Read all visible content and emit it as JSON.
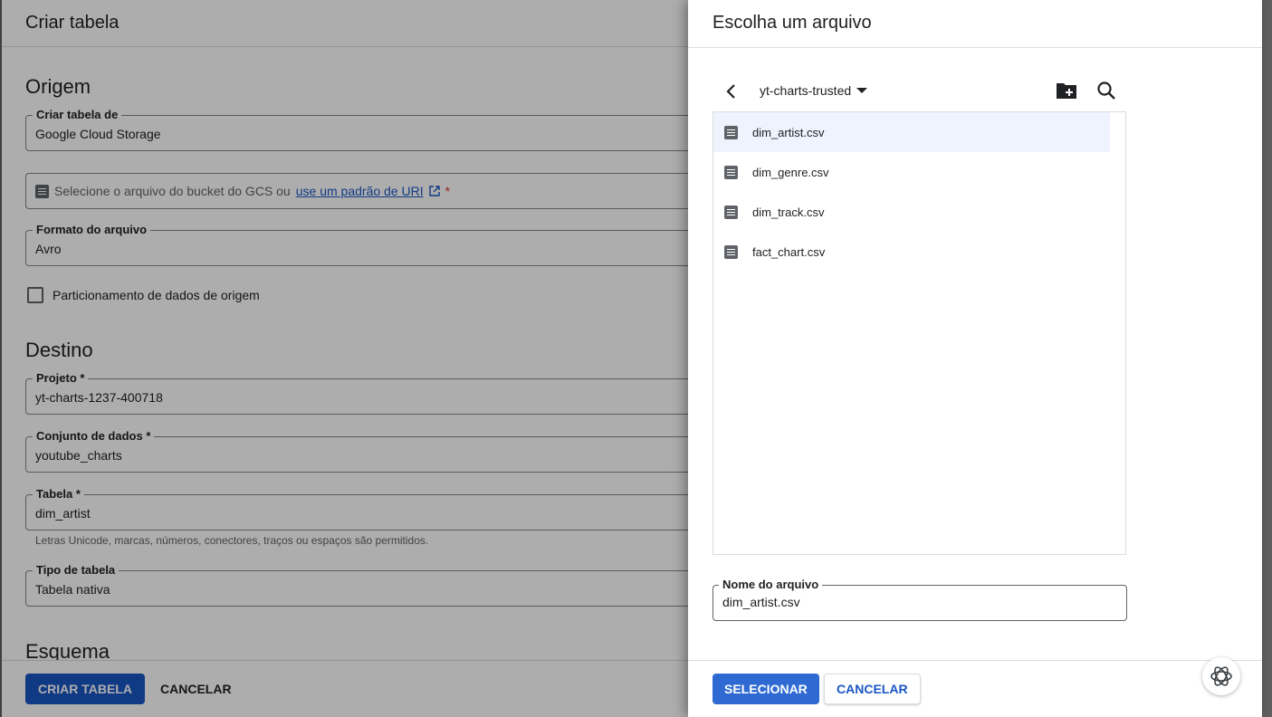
{
  "left": {
    "title": "Criar tabela",
    "origin_title": "Origem",
    "create_from_label": "Criar tabela de",
    "create_from_value": "Google Cloud Storage",
    "gcs_text": "Selecione o arquivo do bucket do GCS ou",
    "gcs_link": "use um padrão de URI",
    "required_mark": "*",
    "format_label": "Formato do arquivo",
    "format_value": "Avro",
    "partition_label": "Particionamento de dados de origem",
    "dest_title": "Destino",
    "project_label": "Projeto *",
    "project_value": "yt-charts-1237-400718",
    "dataset_label": "Conjunto de dados *",
    "dataset_value": "youtube_charts",
    "table_label": "Tabela *",
    "table_value": "dim_artist",
    "table_hint": "Letras Unicode, marcas, números, conectores, traços ou espaços são permitidos.",
    "table_type_label": "Tipo de tabela",
    "table_type_value": "Tabela nativa",
    "schema_title": "Esquema",
    "create_button": "CRIAR TABELA",
    "cancel_button": "CANCELAR"
  },
  "drawer": {
    "title": "Escolha um arquivo",
    "bucket": "yt-charts-trusted",
    "files": [
      "dim_artist.csv",
      "dim_genre.csv",
      "dim_track.csv",
      "fact_chart.csv"
    ],
    "selected_index": 0,
    "filename_label": "Nome do arquivo",
    "filename_value": "dim_artist.csv",
    "select_button": "SELECIONAR",
    "cancel_button": "CANCELAR"
  },
  "colors": {
    "primary": "#1a56c4",
    "selected_row": "#eef3fd"
  },
  "icons": {
    "back": "chevron-left-icon",
    "bucket_dropdown": "caret-down-icon",
    "new_folder": "create-folder-icon",
    "search": "search-icon",
    "file": "document-icon",
    "external_link": "external-link-icon",
    "assistant": "assistant-logo-icon"
  }
}
